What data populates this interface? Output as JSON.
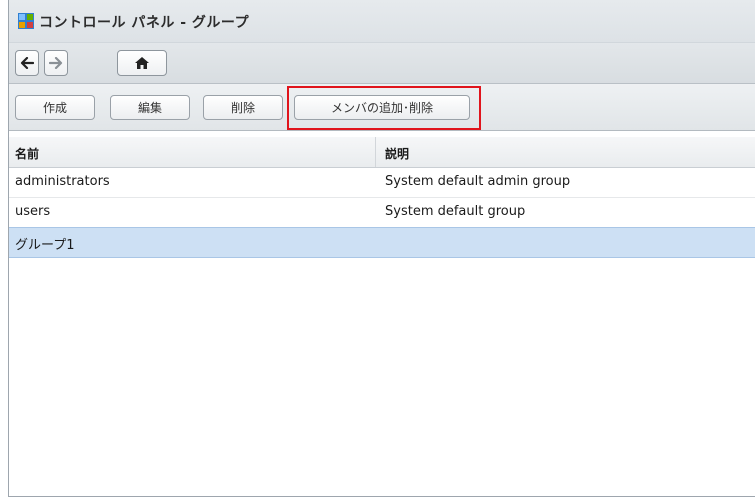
{
  "window": {
    "title": "コントロール パネル - グループ"
  },
  "nav": {
    "back_icon": "arrow-left-icon",
    "forward_icon": "arrow-right-icon",
    "home_icon": "home-icon"
  },
  "toolbar": {
    "create_label": "作成",
    "edit_label": "編集",
    "delete_label": "削除",
    "members_label": "メンバの追加･削除"
  },
  "table": {
    "columns": [
      "名前",
      "説明"
    ],
    "rows": [
      {
        "name": "administrators",
        "description": "System default admin group"
      },
      {
        "name": "users",
        "description": "System default group"
      },
      {
        "name": "グループ1",
        "description": ""
      }
    ],
    "selected_row": 2
  },
  "colors": {
    "highlight": "#e0141c",
    "selected_row": "#cde0f4"
  }
}
